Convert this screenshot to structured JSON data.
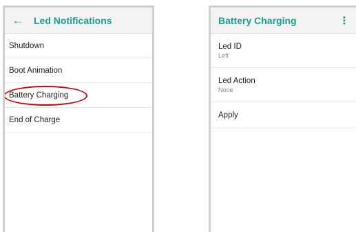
{
  "colors": {
    "accent": "#1a9e92",
    "highlight": "#d40000"
  },
  "left_screen": {
    "title": "Led Notifications",
    "back_icon": "arrow-left-icon",
    "items": [
      {
        "label": "Shutdown"
      },
      {
        "label": "Boot Animation"
      },
      {
        "label": "Battery Charging"
      },
      {
        "label": "End of Charge"
      }
    ]
  },
  "right_screen": {
    "title": "Battery Charging",
    "menu_icon": "more-vert-icon",
    "preferences": [
      {
        "title": "Led ID",
        "summary": "Left"
      },
      {
        "title": "Led Action",
        "summary": "None"
      },
      {
        "title": "Apply",
        "summary": ""
      }
    ]
  }
}
